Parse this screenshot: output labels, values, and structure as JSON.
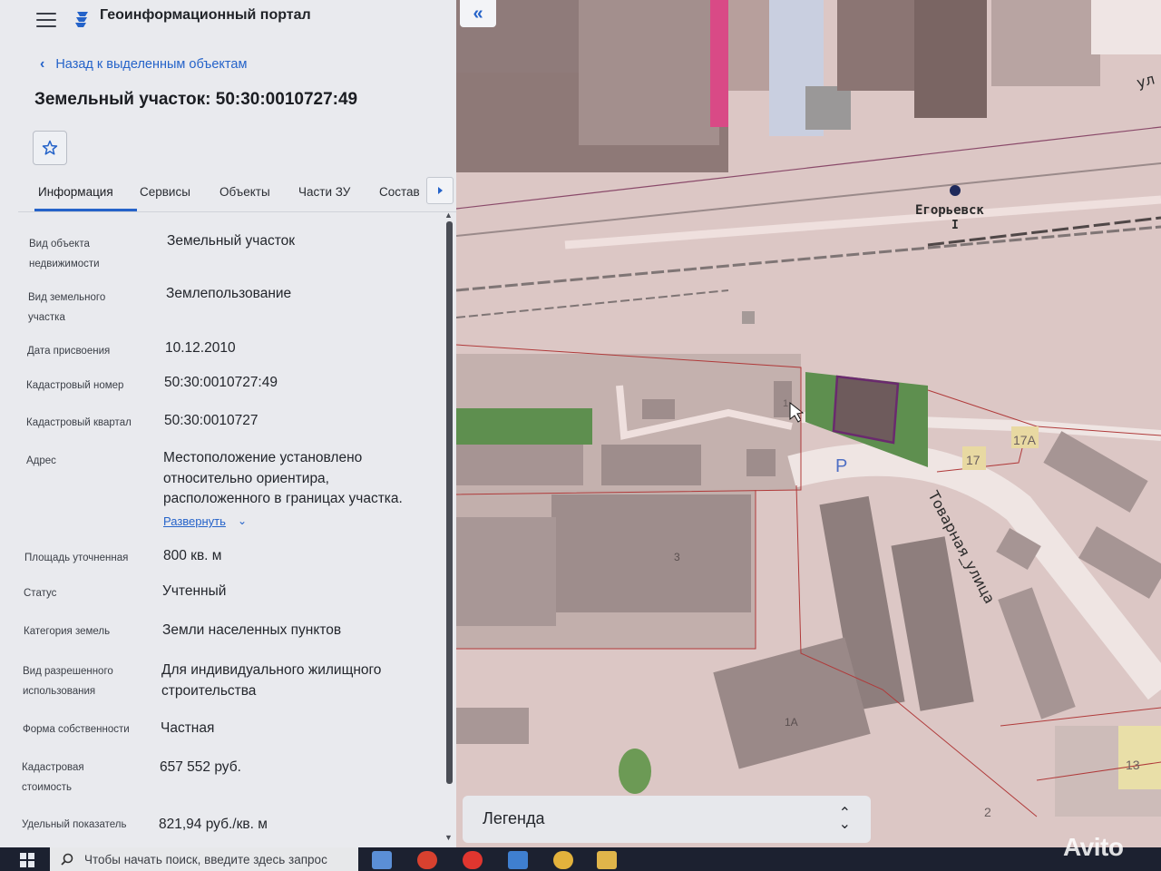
{
  "app": {
    "title": "Геоинформационный портал",
    "back_label": "Назад к выделенным объектам",
    "object_title": "Земельный участок: 50:30:0010727:49"
  },
  "tabs": [
    {
      "label": "Информация",
      "active": true
    },
    {
      "label": "Сервисы"
    },
    {
      "label": "Объекты"
    },
    {
      "label": "Части ЗУ"
    },
    {
      "label": "Состав"
    }
  ],
  "info": [
    {
      "label_lines": [
        "Вид объекта",
        "недвижимости"
      ],
      "value_lines": [
        "Земельный участок"
      ]
    },
    {
      "label_lines": [
        "Вид земельного",
        "участка"
      ],
      "value_lines": [
        "Землепользование"
      ]
    },
    {
      "label_lines": [
        "Дата присвоения"
      ],
      "value_lines": [
        "10.12.2010"
      ]
    },
    {
      "label_lines": [
        "Кадастровый номер"
      ],
      "value_lines": [
        "50:30:0010727:49"
      ]
    },
    {
      "label_lines": [
        "Кадастровый квартал"
      ],
      "value_lines": [
        "50:30:0010727"
      ]
    },
    {
      "label_lines": [
        "Адрес"
      ],
      "value_lines": [
        "Местоположение установлено",
        "относительно ориентира,",
        "расположенного в границах участка."
      ]
    },
    {
      "label_lines": [
        "Площадь уточненная"
      ],
      "value_lines": [
        "800 кв. м"
      ]
    },
    {
      "label_lines": [
        "Статус"
      ],
      "value_lines": [
        "Учтенный"
      ]
    },
    {
      "label_lines": [
        "Категория земель"
      ],
      "value_lines": [
        "Земли населенных пунктов"
      ]
    },
    {
      "label_lines": [
        "Вид разрешенного",
        "использования"
      ],
      "value_lines": [
        "Для индивидуального жилищного",
        "строительства"
      ]
    },
    {
      "label_lines": [
        "Форма собственности"
      ],
      "value_lines": [
        "Частная"
      ]
    },
    {
      "label_lines": [
        "Кадастровая",
        "стоимость"
      ],
      "value_lines": [
        "657 552 руб."
      ]
    },
    {
      "label_lines": [
        "Удельный показатель"
      ],
      "value_lines": [
        "821,94 руб./кв. м"
      ]
    }
  ],
  "expand_label": "Развернуть",
  "map": {
    "station_label": "Егорьевск",
    "station_sub": "I",
    "street_label": "Товарная_улица",
    "street_partial": "ул",
    "parking_label": "P",
    "house_numbers": [
      "17А",
      "17",
      "3",
      "1А",
      "13",
      "2",
      "3",
      "1"
    ],
    "legend_label": "Легенда"
  },
  "taskbar": {
    "search_placeholder": "Чтобы начать поиск, введите здесь запрос"
  },
  "watermark": "Avito",
  "colors": {
    "accent": "#2563c9",
    "map_background": "#dcc7c5",
    "green_zone": "#5e8f4f",
    "selected_parcel": "#6a2a6e"
  }
}
